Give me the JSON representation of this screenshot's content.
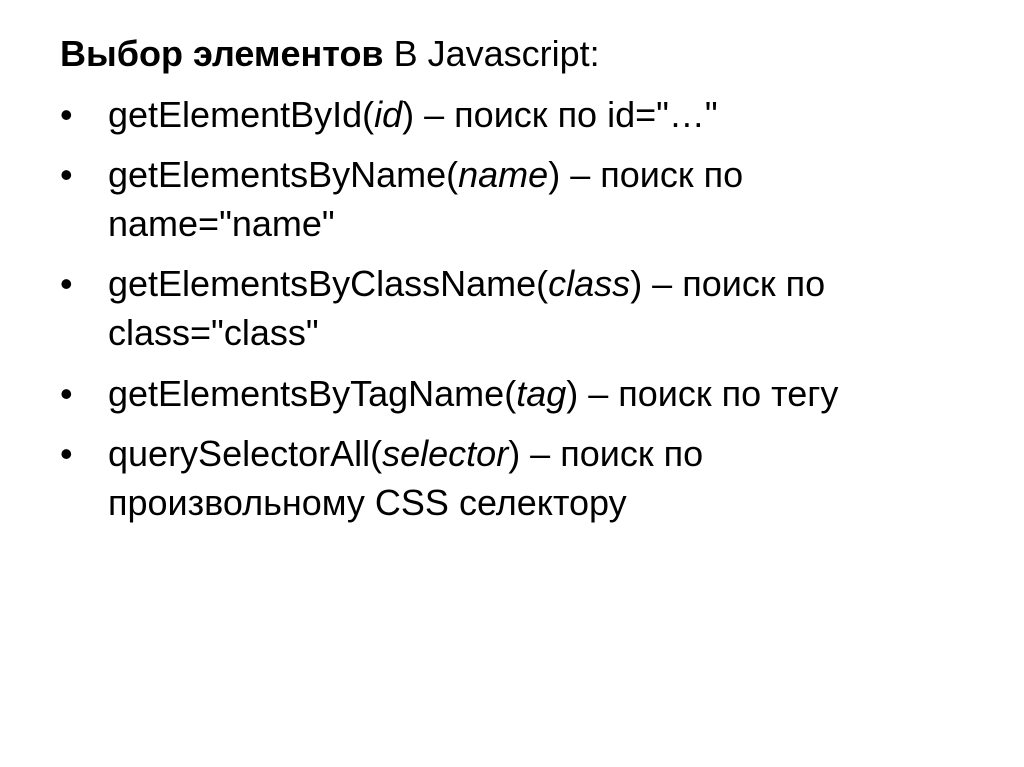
{
  "heading": {
    "bold": "Выбор элементов",
    "rest": "  В Javascript:"
  },
  "items": [
    {
      "pre": "getElementById(",
      "param": "id",
      "post": ") – поиск по id=\"…\""
    },
    {
      "pre": "getElementsByName(",
      "param": "name",
      "post": ") – поиск по name=\"name\""
    },
    {
      "pre": "getElementsByClassName(",
      "param": "class",
      "post": ") – поиск по class=\"class\""
    },
    {
      "pre": "getElementsByTagName(",
      "param": "tag",
      "post": ") – поиск по тегу"
    },
    {
      "pre": "querySelectorAll(",
      "param": "selector",
      "post": ") – поиск по произвольному CSS селектору"
    }
  ],
  "bullet": "•"
}
